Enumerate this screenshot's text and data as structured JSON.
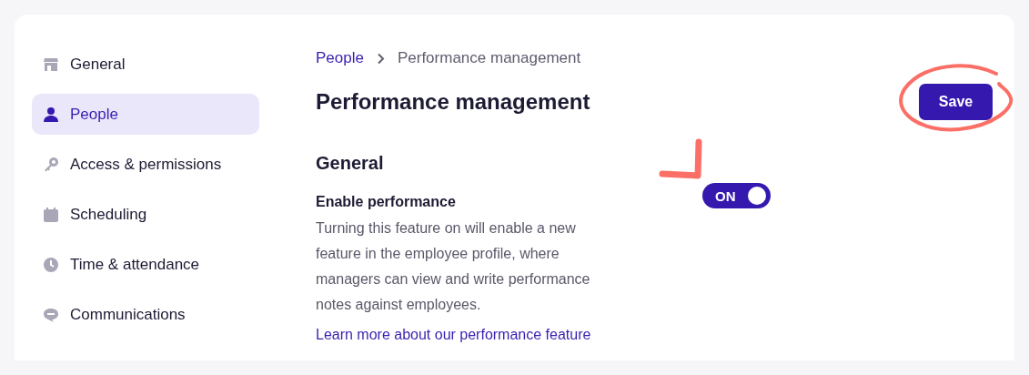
{
  "sidebar": {
    "items": [
      {
        "label": "General",
        "selected": false
      },
      {
        "label": "People",
        "selected": true
      },
      {
        "label": "Access & permissions",
        "selected": false
      },
      {
        "label": "Scheduling",
        "selected": false
      },
      {
        "label": "Time & attendance",
        "selected": false
      },
      {
        "label": "Communications",
        "selected": false
      }
    ]
  },
  "breadcrumb": [
    {
      "label": "People",
      "kind": "link"
    },
    {
      "label": "Performance management",
      "kind": "current"
    }
  ],
  "title": "Performance management",
  "save_button": "Save",
  "section": {
    "heading": "General",
    "settings": [
      {
        "kind": "toggle",
        "label": "Enable performance",
        "description": "Turning this feature on will enable a new feature in the employee profile, where managers can view and write performance notes against employees.",
        "link": "Learn more about our performance feature",
        "on": true,
        "toggle_label": "ON"
      }
    ]
  }
}
